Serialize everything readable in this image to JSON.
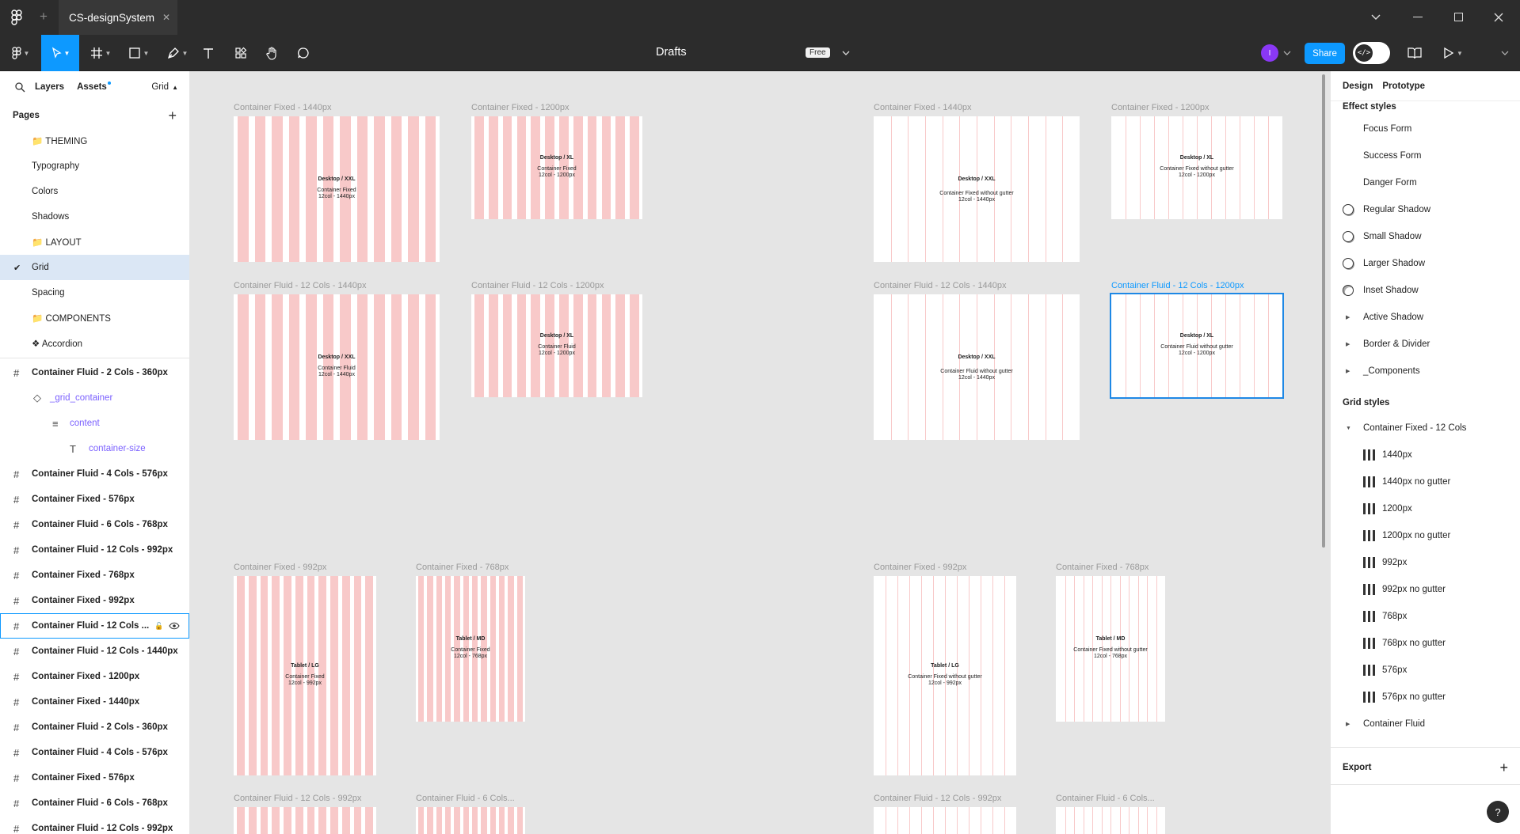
{
  "titlebar": {
    "tab_title": "CS-designSystem",
    "close_glyph": "✕",
    "new_tab_glyph": "+"
  },
  "toolbar": {
    "file_name": "Drafts",
    "plan_badge": "Free",
    "share_label": "Share",
    "avatar_initial": "I"
  },
  "left": {
    "tabs": {
      "layers": "Layers",
      "assets": "Assets",
      "page_dropdown": "Grid"
    },
    "pages_title": "Pages",
    "pages": [
      {
        "label": "📁 THEMING"
      },
      {
        "label": "Typography"
      },
      {
        "label": "Colors"
      },
      {
        "label": "Shadows"
      },
      {
        "label": "📁 LAYOUT"
      },
      {
        "label": "Grid",
        "selected": true
      },
      {
        "label": "Spacing"
      },
      {
        "label": "📁 COMPONENTS"
      },
      {
        "label": "❖ Accordion"
      }
    ],
    "layers": [
      {
        "label": "Container Fluid - 2 Cols - 360px",
        "icon": "frame-icon",
        "type": "frame"
      },
      {
        "label": "_grid_container",
        "icon": "component-instance-icon",
        "type": "sub1"
      },
      {
        "label": "content",
        "icon": "auto-layout-icon",
        "type": "sub2"
      },
      {
        "label": "container-size",
        "icon": "text-icon",
        "type": "sub3"
      },
      {
        "label": "Container Fluid - 4 Cols - 576px",
        "icon": "frame-icon",
        "type": "frame"
      },
      {
        "label": "Container Fixed - 576px",
        "icon": "frame-icon",
        "type": "frame"
      },
      {
        "label": "Container Fluid - 6 Cols - 768px",
        "icon": "frame-icon",
        "type": "frame"
      },
      {
        "label": "Container Fluid - 12 Cols - 992px",
        "icon": "frame-icon",
        "type": "frame"
      },
      {
        "label": "Container Fixed - 768px",
        "icon": "frame-icon",
        "type": "frame"
      },
      {
        "label": "Container Fixed - 992px",
        "icon": "frame-icon",
        "type": "frame"
      },
      {
        "label": "Container Fluid - 12 Cols ...",
        "icon": "frame-icon",
        "type": "frame",
        "hover": true
      },
      {
        "label": "Container Fluid - 12 Cols - 1440px",
        "icon": "frame-icon",
        "type": "frame"
      },
      {
        "label": "Container Fixed - 1200px",
        "icon": "frame-icon",
        "type": "frame"
      },
      {
        "label": "Container Fixed - 1440px",
        "icon": "frame-icon",
        "type": "frame"
      },
      {
        "label": "Container Fluid - 2 Cols - 360px",
        "icon": "frame-icon",
        "type": "frame"
      },
      {
        "label": "Container Fluid - 4 Cols - 576px",
        "icon": "frame-icon",
        "type": "frame"
      },
      {
        "label": "Container Fixed - 576px",
        "icon": "frame-icon",
        "type": "frame"
      },
      {
        "label": "Container Fluid - 6 Cols - 768px",
        "icon": "frame-icon",
        "type": "frame"
      },
      {
        "label": "Container Fluid - 12 Cols - 992px",
        "icon": "frame-icon",
        "type": "frame"
      }
    ]
  },
  "right": {
    "tabs": {
      "design": "Design",
      "prototype": "Prototype"
    },
    "effect_styles_title": "Effect styles",
    "effect_styles": [
      {
        "label": "Focus Form",
        "kind": "none"
      },
      {
        "label": "Success Form",
        "kind": "none"
      },
      {
        "label": "Danger Form",
        "kind": "none"
      },
      {
        "label": "Regular Shadow",
        "kind": "shadow"
      },
      {
        "label": "Small Shadow",
        "kind": "shadow"
      },
      {
        "label": "Larger Shadow",
        "kind": "shadow"
      },
      {
        "label": "Inset Shadow",
        "kind": "inset"
      },
      {
        "label": "Active Shadow",
        "kind": "group"
      },
      {
        "label": "Border & Divider",
        "kind": "group"
      },
      {
        "label": "_Components",
        "kind": "group"
      }
    ],
    "grid_styles_title": "Grid styles",
    "grid_group_open": "Container Fixed - 12 Cols",
    "grid_styles": [
      "1440px",
      "1440px no gutter",
      "1200px",
      "1200px no gutter",
      "992px",
      "992px no gutter",
      "768px",
      "768px no gutter",
      "576px",
      "576px no gutter"
    ],
    "grid_group_closed": "Container Fluid",
    "export_title": "Export",
    "help_glyph": "?"
  },
  "canvas": {
    "frames": [
      {
        "label": "Container Fixed - 1440px",
        "device": "Desktop / XXL",
        "name": "Container Fixed",
        "spec": "12col - 1440px",
        "style": "pink"
      },
      {
        "label": "Container Fixed - 1200px",
        "device": "Desktop / XL",
        "name": "Container Fixed",
        "spec": "12col - 1200px",
        "style": "pink"
      },
      {
        "label": "Container Fixed - 1440px",
        "device": "Desktop / XXL",
        "name": "Container Fixed without gutter",
        "spec": "12col - 1440px",
        "style": "white"
      },
      {
        "label": "Container Fixed - 1200px",
        "device": "Desktop / XL",
        "name": "Container Fixed without gutter",
        "spec": "12col - 1200px",
        "style": "white"
      },
      {
        "label": "Container Fluid - 12 Cols - 1440px",
        "device": "Desktop / XXL",
        "name": "Container Fluid",
        "spec": "12col - 1440px",
        "style": "pink"
      },
      {
        "label": "Container Fluid - 12 Cols - 1200px",
        "device": "Desktop / XL",
        "name": "Container Fluid",
        "spec": "12col - 1200px",
        "style": "pink"
      },
      {
        "label": "Container Fluid - 12 Cols - 1440px",
        "device": "Desktop / XXL",
        "name": "Container Fluid without gutter",
        "spec": "12col - 1440px",
        "style": "white"
      },
      {
        "label": "Container Fluid - 12 Cols - 1200px",
        "device": "Desktop / XL",
        "name": "Container Fluid without gutter",
        "spec": "12col - 1200px",
        "style": "white",
        "selected": true
      },
      {
        "label": "Container Fixed - 992px",
        "device": "Tablet / LG",
        "name": "Container Fixed",
        "spec": "12col - 992px",
        "style": "pink"
      },
      {
        "label": "Container Fixed - 768px",
        "device": "Tablet / MD",
        "name": "Container Fixed",
        "spec": "12col - 768px",
        "style": "pink"
      },
      {
        "label": "Container Fixed - 992px",
        "device": "Tablet / LG",
        "name": "Container Fixed without gutter",
        "spec": "12col - 992px",
        "style": "white"
      },
      {
        "label": "Container Fixed - 768px",
        "device": "Tablet / MD",
        "name": "Container Fixed without gutter",
        "spec": "12col - 768px",
        "style": "white"
      },
      {
        "label": "Container Fluid - 12 Cols - 992px",
        "device": "",
        "name": "",
        "spec": "",
        "style": "pink"
      },
      {
        "label": "Container Fluid - 6 Cols...",
        "device": "",
        "name": "",
        "spec": "",
        "style": "pink"
      },
      {
        "label": "Container Fluid - 12 Cols - 992px",
        "device": "",
        "name": "",
        "spec": "",
        "style": "white"
      },
      {
        "label": "Container Fluid - 6 Cols...",
        "device": "",
        "name": "",
        "spec": "",
        "style": "white"
      }
    ]
  },
  "colors": {
    "accent": "#0d99ff",
    "toolbar_bg": "#2c2c2c",
    "grid_pink": "#f8c9c9",
    "selection": "#1e88e5"
  }
}
